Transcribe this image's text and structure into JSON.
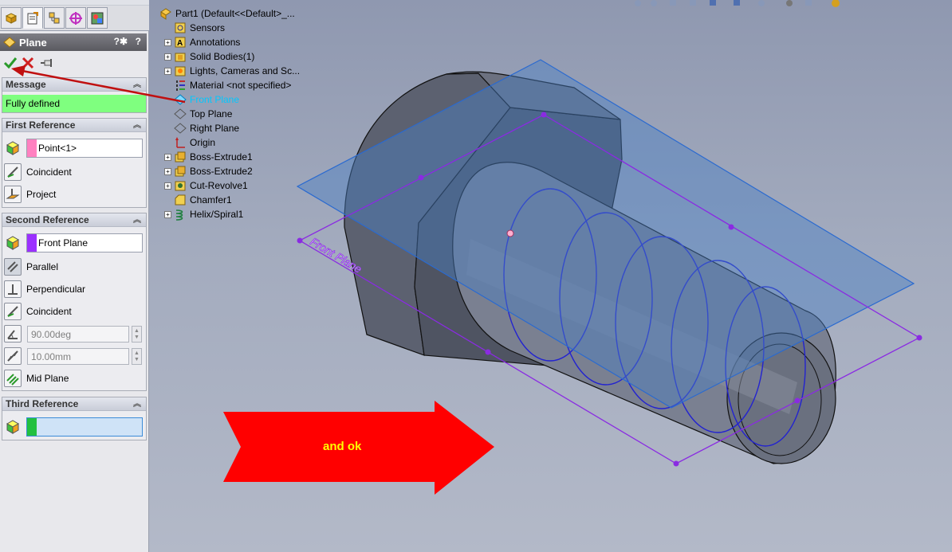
{
  "property_manager": {
    "title": "Plane",
    "help_glyph": "?",
    "ok_label": "OK",
    "cancel_label": "Cancel",
    "pin_label": "Keep visible",
    "message_section": {
      "title": "Message",
      "status_text": "Fully defined",
      "status_color": "#7fff7f"
    },
    "first_reference": {
      "title": "First Reference",
      "selection": "Point<1>",
      "swatch_color": "#ff80c0",
      "options": [
        "Coincident",
        "Project"
      ]
    },
    "second_reference": {
      "title": "Second Reference",
      "selection": "Front Plane",
      "swatch_color": "#9b30ff",
      "options": [
        "Parallel",
        "Perpendicular",
        "Coincident"
      ],
      "angle_value": "90.00deg",
      "distance_value": "10.00mm",
      "mid_plane_label": "Mid Plane"
    },
    "third_reference": {
      "title": "Third Reference",
      "selection": "",
      "swatch_color": "#22c040"
    }
  },
  "feature_tree": {
    "items": [
      {
        "label": "Part1  (Default<<Default>_...",
        "icon": "part-icon",
        "expandable": false
      },
      {
        "label": "Sensors",
        "icon": "sensors-icon",
        "expandable": false
      },
      {
        "label": "Annotations",
        "icon": "annotations-icon",
        "expandable": true
      },
      {
        "label": "Solid Bodies(1)",
        "icon": "solid-bodies-icon",
        "expandable": true
      },
      {
        "label": "Lights, Cameras and Sc...",
        "icon": "lights-icon",
        "expandable": true
      },
      {
        "label": "Material <not specified>",
        "icon": "material-icon",
        "expandable": false
      },
      {
        "label": "Front Plane",
        "icon": "plane-icon",
        "expandable": false,
        "selected": true
      },
      {
        "label": "Top Plane",
        "icon": "plane-icon",
        "expandable": false
      },
      {
        "label": "Right Plane",
        "icon": "plane-icon",
        "expandable": false
      },
      {
        "label": "Origin",
        "icon": "origin-icon",
        "expandable": false
      },
      {
        "label": "Boss-Extrude1",
        "icon": "extrude-icon",
        "expandable": true
      },
      {
        "label": "Boss-Extrude2",
        "icon": "extrude-icon",
        "expandable": true
      },
      {
        "label": "Cut-Revolve1",
        "icon": "cut-revolve-icon",
        "expandable": true
      },
      {
        "label": "Chamfer1",
        "icon": "chamfer-icon",
        "expandable": false
      },
      {
        "label": "Helix/Spiral1",
        "icon": "helix-icon",
        "expandable": true
      }
    ]
  },
  "viewport": {
    "plane_label": "Front Plane",
    "annotation_text": "and ok",
    "annotation_color": "#ff0000",
    "annotation_text_color": "#ffff00",
    "plane_color": "#9b30ff"
  }
}
